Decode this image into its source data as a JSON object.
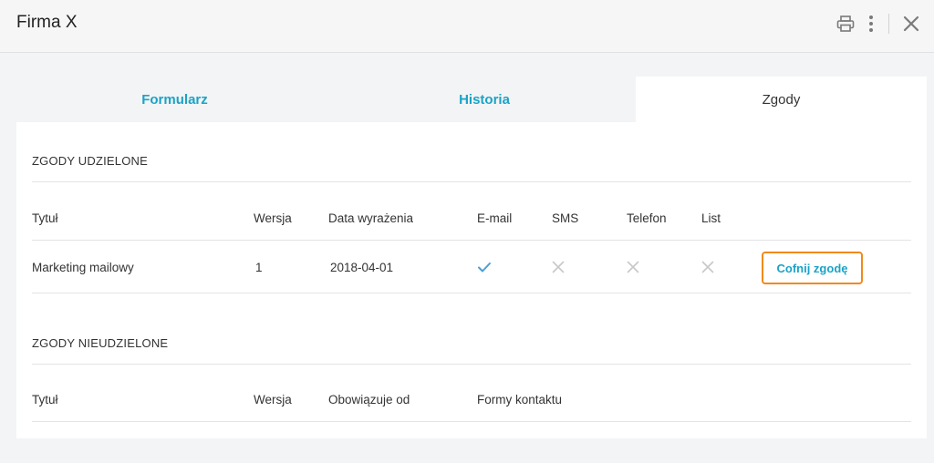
{
  "window": {
    "title": "Firma X"
  },
  "toolbar": {
    "icons": [
      "print-icon",
      "more-vertical-icon",
      "close-icon"
    ]
  },
  "tabs": [
    {
      "label": "Formularz",
      "active": false
    },
    {
      "label": "Historia",
      "active": false
    },
    {
      "label": "Zgody",
      "active": true
    }
  ],
  "granted": {
    "title": "ZGODY UDZIELONE",
    "columns": [
      "Tytuł",
      "Wersja",
      "Data wyrażenia",
      "E-mail",
      "SMS",
      "Telefon",
      "List"
    ],
    "rows": [
      {
        "title": "Marketing mailowy",
        "version": "1",
        "date": "2018-04-01",
        "email": true,
        "sms": false,
        "phone": false,
        "letter": false,
        "action": "Cofnij zgodę"
      }
    ]
  },
  "not_granted": {
    "title": "ZGODY NIEUDZIELONE",
    "columns": [
      "Tytuł",
      "Wersja",
      "Obowiązuje od",
      "Formy kontaktu"
    ]
  },
  "colors": {
    "accent": "#1aa3c7",
    "highlight": "#f08a1c",
    "check": "#4a9fd5",
    "cross": "#c8c8c8"
  }
}
